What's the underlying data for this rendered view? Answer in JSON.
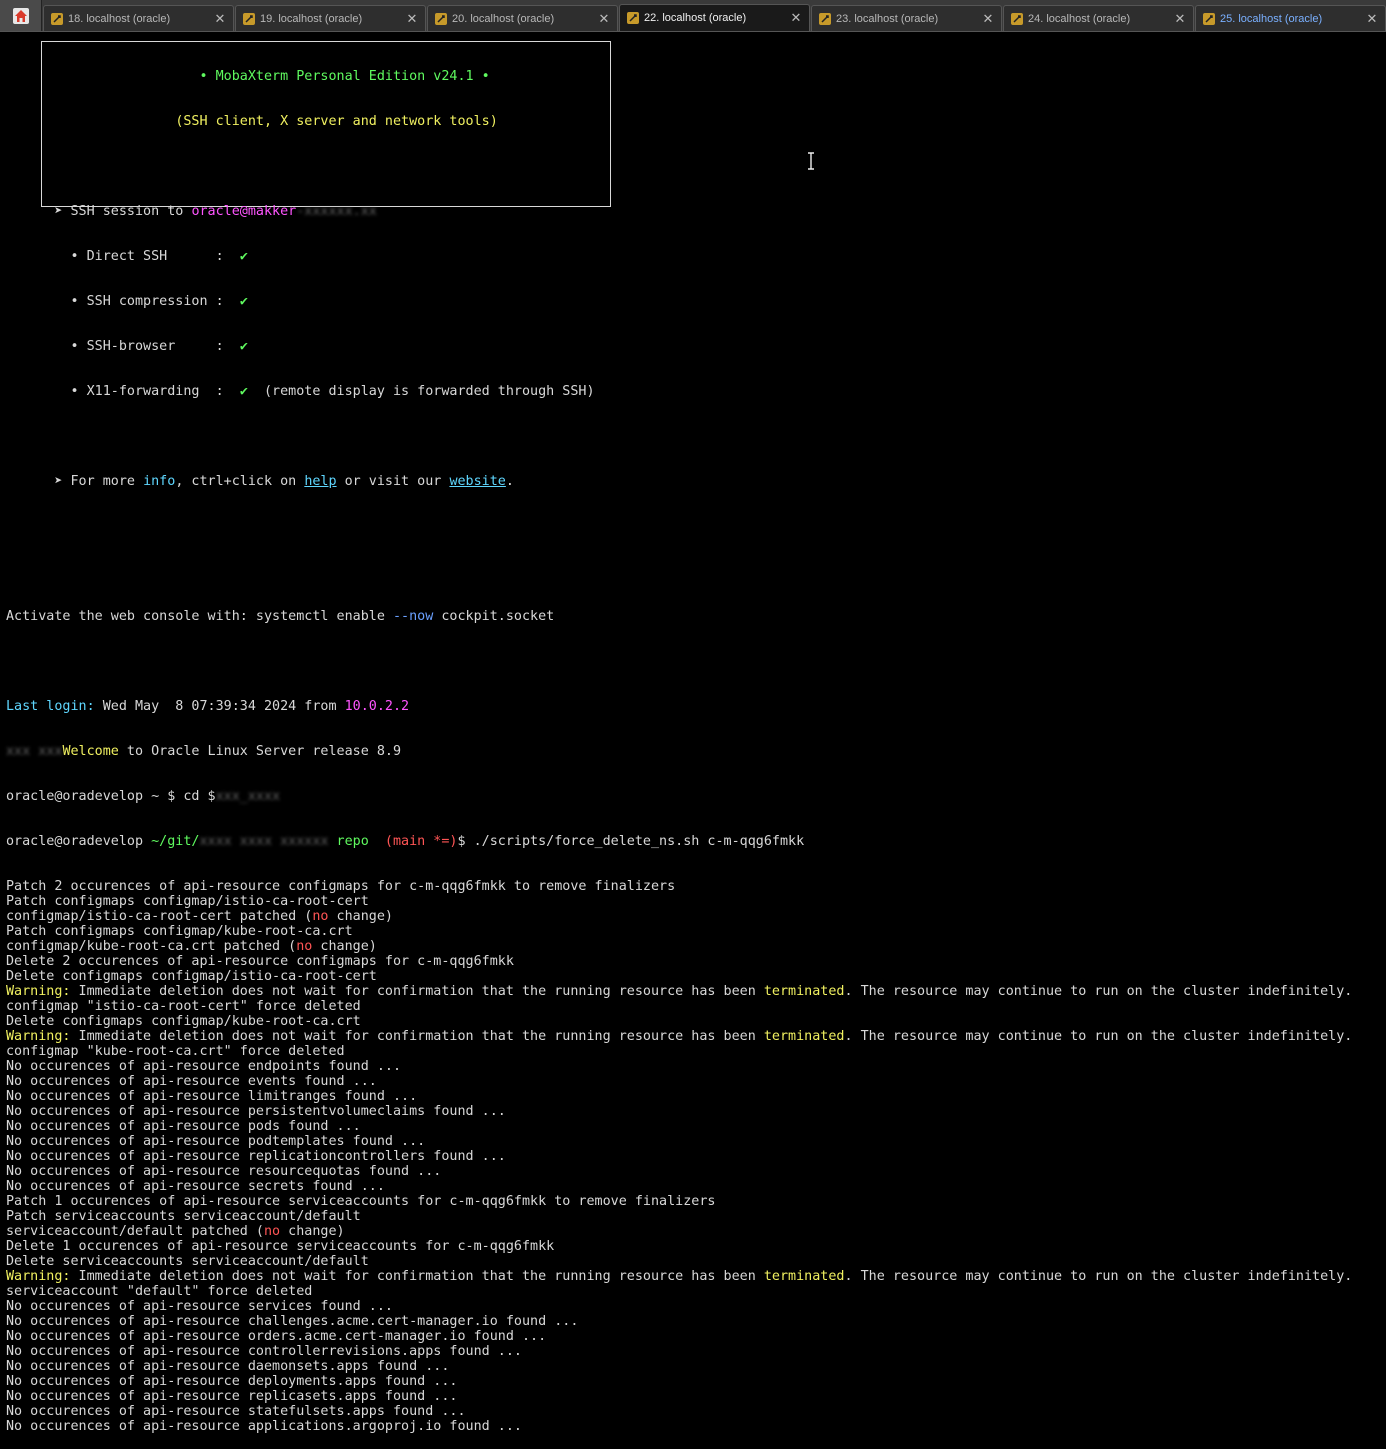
{
  "tabs": [
    {
      "label": "18. localhost (oracle)",
      "active": false
    },
    {
      "label": "19. localhost (oracle)",
      "active": false
    },
    {
      "label": "20. localhost (oracle)",
      "active": false
    },
    {
      "label": "22. localhost (oracle)",
      "active": true
    },
    {
      "label": "23. localhost (oracle)",
      "active": false
    },
    {
      "label": "24. localhost (oracle)",
      "active": false
    },
    {
      "label": "25. localhost (oracle)",
      "active": false
    }
  ],
  "banner": {
    "title": "• MobaXterm Personal Edition v24.1 •",
    "subtitle": "(SSH client, X server and network tools)",
    "ssh_prefix": "➤ SSH session to ",
    "ssh_target": "oracle@makker",
    "direct_ssh": "  • Direct SSH      :  ",
    "ssh_compression": "  • SSH compression :  ",
    "ssh_browser": "  • SSH-browser     :  ",
    "x11": "  • X11-forwarding  :  ",
    "check": "✔",
    "x11_note": "  (remote display is forwarded through SSH)",
    "more_a": "➤ For more ",
    "info": "info",
    "more_b": ", ctrl+click on ",
    "help": "help",
    "more_c": " or visit our ",
    "website": "website",
    "more_d": "."
  },
  "console": {
    "activate_a": "Activate the web console with: systemctl enable ",
    "activate_flag": "--now",
    "activate_b": " cockpit.socket",
    "last_login_label": "Last login:",
    "last_login_value": " Wed May  8 07:39:34 2024 from ",
    "last_login_ip": "10.0.2.2",
    "welcome_a": "Welcome",
    "welcome_b": " to Oracle Linux Server release 8.9",
    "prompt1": "oracle@oradevelop ~ $ cd $",
    "prompt2_user": "oracle@oradevelop",
    "prompt2_path": " ~/git/",
    "prompt2_repo": " repo",
    "prompt2_branch": "  (main *=)",
    "prompt2_cmd": "$ ./scripts/force_delete_ns.sh c-m-qqg6fmkk"
  },
  "warning": {
    "label": "Warning:",
    "text_a": " Immediate deletion does not wait for confirmation that the running resource has been ",
    "terminated": "terminated",
    "text_b": ". The resource may continue to run on the cluster indefinitely."
  },
  "output": [
    {
      "t": "plain",
      "text": "Patch 2 occurences of api-resource configmaps for c-m-qqg6fmkk to remove finalizers"
    },
    {
      "t": "plain",
      "text": "Patch configmaps configmap/istio-ca-root-cert"
    },
    {
      "t": "nochange",
      "a": "configmap/istio-ca-root-cert patched (",
      "no": "no",
      "b": " change)"
    },
    {
      "t": "plain",
      "text": "Patch configmaps configmap/kube-root-ca.crt"
    },
    {
      "t": "nochange",
      "a": "configmap/kube-root-ca.crt patched (",
      "no": "no",
      "b": " change)"
    },
    {
      "t": "plain",
      "text": "Delete 2 occurences of api-resource configmaps for c-m-qqg6fmkk"
    },
    {
      "t": "plain",
      "text": "Delete configmaps configmap/istio-ca-root-cert"
    },
    {
      "t": "warning"
    },
    {
      "t": "plain",
      "text": "configmap \"istio-ca-root-cert\" force deleted"
    },
    {
      "t": "plain",
      "text": "Delete configmaps configmap/kube-root-ca.crt"
    },
    {
      "t": "warning"
    },
    {
      "t": "plain",
      "text": "configmap \"kube-root-ca.crt\" force deleted"
    },
    {
      "t": "plain",
      "text": "No occurences of api-resource endpoints found ..."
    },
    {
      "t": "plain",
      "text": "No occurences of api-resource events found ..."
    },
    {
      "t": "plain",
      "text": "No occurences of api-resource limitranges found ..."
    },
    {
      "t": "plain",
      "text": "No occurences of api-resource persistentvolumeclaims found ..."
    },
    {
      "t": "plain",
      "text": "No occurences of api-resource pods found ..."
    },
    {
      "t": "plain",
      "text": "No occurences of api-resource podtemplates found ..."
    },
    {
      "t": "plain",
      "text": "No occurences of api-resource replicationcontrollers found ..."
    },
    {
      "t": "plain",
      "text": "No occurences of api-resource resourcequotas found ..."
    },
    {
      "t": "plain",
      "text": "No occurences of api-resource secrets found ..."
    },
    {
      "t": "plain",
      "text": "Patch 1 occurences of api-resource serviceaccounts for c-m-qqg6fmkk to remove finalizers"
    },
    {
      "t": "plain",
      "text": "Patch serviceaccounts serviceaccount/default"
    },
    {
      "t": "nochange",
      "a": "serviceaccount/default patched (",
      "no": "no",
      "b": " change)"
    },
    {
      "t": "plain",
      "text": "Delete 1 occurences of api-resource serviceaccounts for c-m-qqg6fmkk"
    },
    {
      "t": "plain",
      "text": "Delete serviceaccounts serviceaccount/default"
    },
    {
      "t": "warning"
    },
    {
      "t": "plain",
      "text": "serviceaccount \"default\" force deleted"
    },
    {
      "t": "plain",
      "text": "No occurences of api-resource services found ..."
    },
    {
      "t": "plain",
      "text": "No occurences of api-resource challenges.acme.cert-manager.io found ..."
    },
    {
      "t": "plain",
      "text": "No occurences of api-resource orders.acme.cert-manager.io found ..."
    },
    {
      "t": "plain",
      "text": "No occurences of api-resource controllerrevisions.apps found ..."
    },
    {
      "t": "plain",
      "text": "No occurences of api-resource daemonsets.apps found ..."
    },
    {
      "t": "plain",
      "text": "No occurences of api-resource deployments.apps found ..."
    },
    {
      "t": "plain",
      "text": "No occurences of api-resource replicasets.apps found ..."
    },
    {
      "t": "plain",
      "text": "No occurences of api-resource statefulsets.apps found ..."
    },
    {
      "t": "plain",
      "text": "No occurences of api-resource applications.argoproj.io found ..."
    }
  ],
  "colors": {
    "background": "#000000",
    "text": "#d8d8d8",
    "green": "#5ffa5f",
    "yellow": "#f0f060",
    "magenta": "#ff55ff",
    "cyan": "#5fd7ff",
    "red": "#ff5555"
  },
  "icons": {
    "home": "home-icon",
    "tab": "ssh-session-icon",
    "close": "close-icon"
  }
}
